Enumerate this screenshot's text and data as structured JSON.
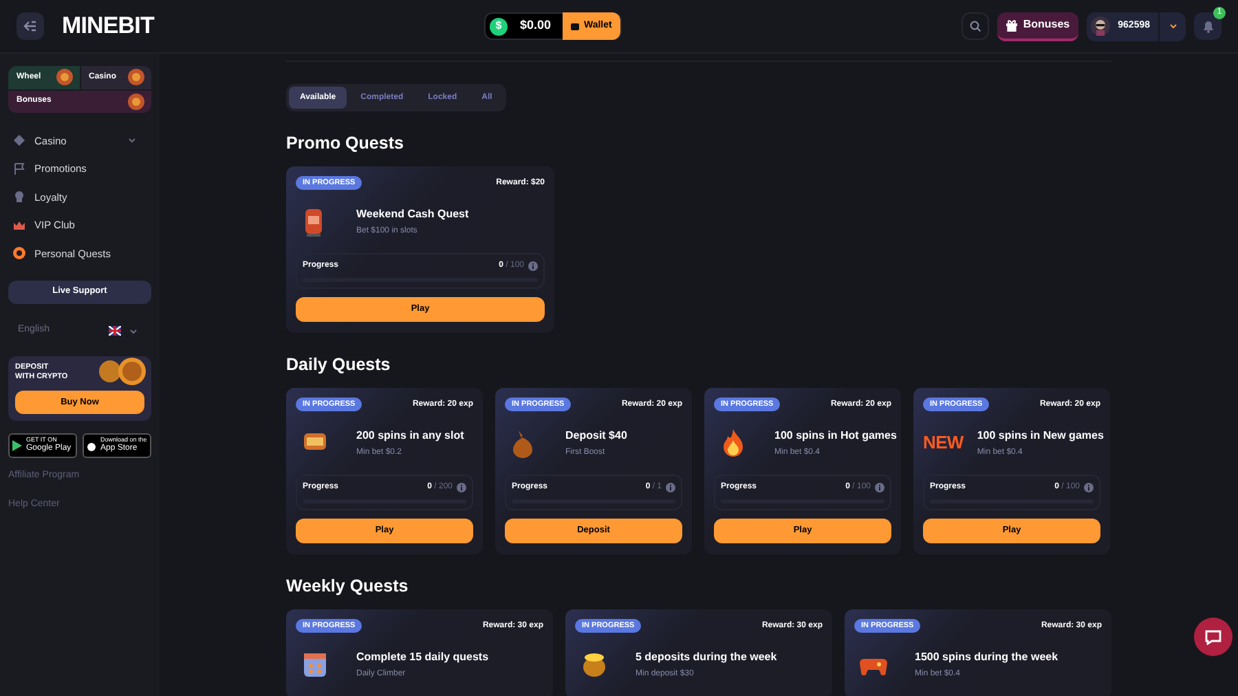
{
  "header": {
    "logo": "MINEBIT",
    "balance": "$0.00",
    "currency_symbol": "$",
    "wallet": "Wallet",
    "bonuses": "Bonuses",
    "username": "962598",
    "notifications": "1"
  },
  "sidebar": {
    "tiles": [
      "Wheel",
      "Casino",
      "Bonuses"
    ],
    "nav": [
      {
        "label": "Casino",
        "expandable": true
      },
      {
        "label": "Promotions",
        "expandable": false
      },
      {
        "label": "Loyalty",
        "expandable": false
      },
      {
        "label": "VIP Club",
        "expandable": false
      },
      {
        "label": "Personal Quests",
        "expandable": false
      }
    ],
    "live_support": "Live Support",
    "language": "English",
    "deposit_card": {
      "title": "DEPOSIT\nWITH CRYPTO",
      "button": "Buy Now"
    },
    "apps": [
      {
        "small": "GET IT ON",
        "big": "Google Play"
      },
      {
        "small": "Download on the",
        "big": "App Store"
      }
    ],
    "links": [
      "Affiliate Program",
      "Help Center"
    ]
  },
  "tabs": [
    {
      "label": "Available",
      "selected": true
    },
    {
      "label": "Completed",
      "selected": false
    },
    {
      "label": "Locked",
      "selected": false
    },
    {
      "label": "All",
      "selected": false
    }
  ],
  "sections": [
    {
      "title": "Promo Quests",
      "quests": [
        {
          "status": "IN PROGRESS",
          "reward": "Reward: $20",
          "title": "Weekend Cash Quest",
          "subtitle": "Bet $100 in slots",
          "progress_label": "Progress",
          "done": "0",
          "total": "/ 100",
          "level": 0,
          "button": "Play"
        }
      ]
    },
    {
      "title": "Daily Quests",
      "quests": [
        {
          "status": "IN PROGRESS",
          "reward": "Reward: 20 exp",
          "title": "200 spins in any slot",
          "subtitle": "Min bet $0.2",
          "progress_label": "Progress",
          "done": "0",
          "total": "/ 200",
          "level": 0,
          "button": "Play"
        },
        {
          "status": "IN PROGRESS",
          "reward": "Reward: 20 exp",
          "title": "Deposit $40",
          "subtitle": "First Boost",
          "progress_label": "Progress",
          "done": "0",
          "total": "/ 1",
          "level": 0,
          "button": "Deposit"
        },
        {
          "status": "IN PROGRESS",
          "reward": "Reward: 20 exp",
          "title": "100 spins in Hot games",
          "subtitle": "Min bet $0.4",
          "progress_label": "Progress",
          "done": "0",
          "total": "/ 100",
          "level": 0,
          "button": "Play"
        },
        {
          "status": "IN PROGRESS",
          "reward": "Reward: 20 exp",
          "icon_text": "NEW",
          "title": "100 spins in New games",
          "subtitle": "Min bet $0.4",
          "progress_label": "Progress",
          "done": "0",
          "total": "/ 100",
          "level": 0,
          "button": "Play"
        }
      ]
    },
    {
      "title": "Weekly Quests",
      "quests": [
        {
          "status": "IN PROGRESS",
          "reward": "Reward: 30 exp",
          "title": "Complete 15 daily quests",
          "subtitle": "Daily Climber"
        },
        {
          "status": "IN PROGRESS",
          "reward": "Reward: 30 exp",
          "title": "5 deposits during the week",
          "subtitle": "Min deposit $30"
        },
        {
          "status": "IN PROGRESS",
          "reward": "Reward: 30 exp",
          "title": "1500 spins during the week",
          "subtitle": "Min bet $0.4"
        }
      ]
    }
  ]
}
